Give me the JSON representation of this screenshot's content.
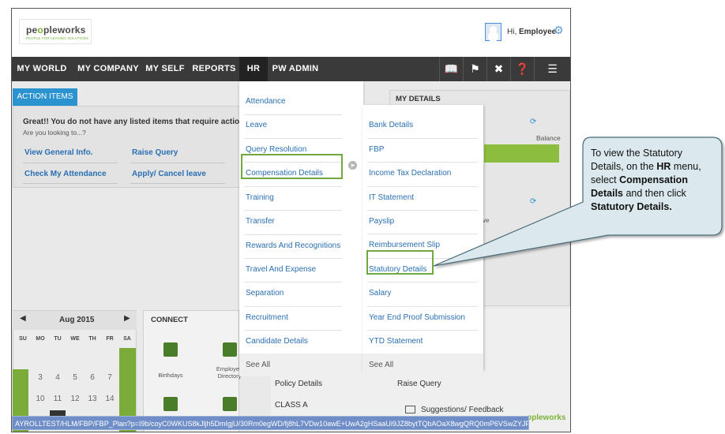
{
  "header": {
    "logo_word_a": "pe",
    "logo_word_b": "o",
    "logo_word_c": "pleworks",
    "logo_tagline": "PEOPLE FOR LEAVING SOLUTIONS",
    "greeting_prefix": "Hi, ",
    "user_name": "Employee"
  },
  "nav": {
    "items": [
      "MY WORLD",
      "MY COMPANY",
      "MY SELF",
      "REPORTS",
      "HR",
      "PW ADMIN"
    ],
    "icons": [
      "book-icon",
      "pin-icon",
      "tools-icon",
      "help-icon",
      "org-chart-icon"
    ],
    "active": "HR"
  },
  "action_items": {
    "tab_label": "ACTION ITEMS",
    "message": "Great!! You do not have any listed items that require action.",
    "sub": "Are you looking to...?",
    "links": [
      "View General Info.",
      "Raise Query",
      "Check My Attendance",
      "Apply/ Cancel leave"
    ]
  },
  "my_details": {
    "title": "MY DETAILS",
    "balance_label": "Balance",
    "partial_ve": "ve"
  },
  "calendar": {
    "month": "Aug 2015",
    "dow": [
      "SU",
      "MO",
      "TU",
      "WE",
      "TH",
      "FR",
      "SA"
    ],
    "row1": [
      "3",
      "4",
      "5",
      "6",
      "7"
    ],
    "row2": [
      "10",
      "11",
      "12",
      "13",
      "14"
    ]
  },
  "connect": {
    "title": "CONNECT",
    "items": [
      "Birthdays",
      "Employee Directory"
    ]
  },
  "bottom": {
    "policy": "Policy Details",
    "class": "CLASS A",
    "raise_query": "Raise Query",
    "feedback": "Suggestions/ Feedback",
    "footer_logo": "opleworks"
  },
  "status_url": "AYROLLTEST/HLM/FBP/FBP_Plan?p=I9b/coyC0WKUS8kJljh5DmIgjU/30Rm0egWD/fj8hL7VDw10awE+UwA2gHSaaUi9JZ8bytTQbAOaX8wgQRQ0mP6VSwZYJFAtqy7rucUevyo=",
  "hr_menu": {
    "left": [
      "Attendance",
      "Leave",
      "Query Resolution",
      "Compensation Details",
      "Training",
      "Transfer",
      "Rewards And Recognitions",
      "Travel And Expense",
      "Separation",
      "Recruitment",
      "Candidate Details"
    ],
    "right": [
      "Bank Details",
      "FBP",
      "Income Tax Declaration",
      "IT Statement",
      "Payslip",
      "Reimbursement Slip",
      "Statutory Details",
      "Salary",
      "Year End Proof Submission",
      "YTD Statement"
    ],
    "see_all_left": "See All",
    "see_all_right": "See All"
  },
  "callout": {
    "t1": "To view the Statutory Details, on the ",
    "t2": "HR",
    "t3": " menu, select ",
    "t4": "Compensation Details",
    "t5": " and then click ",
    "t6": "Statutory Details."
  },
  "colors": {
    "nav_bg": "#3a3a3a",
    "accent_blue": "#2b93d0",
    "highlight_green": "#72a83f",
    "callout_fill": "#dbe8ed"
  }
}
